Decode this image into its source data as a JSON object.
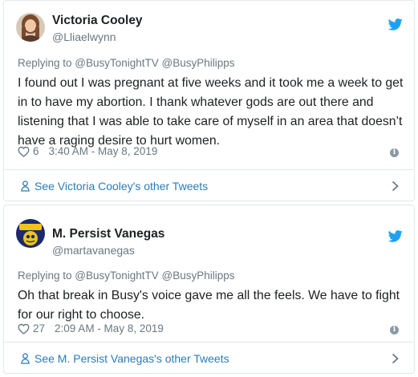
{
  "tweets": [
    {
      "author_name": "Victoria Cooley",
      "handle": "@Lliaelwynn",
      "reply_prefix": "Replying to ",
      "reply_mentions": "@BusyTonightTV @BusyPhilipps",
      "text": "I found out I was pregnant at five weeks and it took me a week to get in to have my abortion. I thank whatever gods are out there and listening that I was able to take care of myself in an area that doesn’t have a raging desire to hurt women.",
      "likes": "6",
      "timestamp": "3:40 AM - May 8, 2019",
      "other_tweets_label": "See Victoria Cooley's other Tweets",
      "avatar_icon": "avatar-photo-woman"
    },
    {
      "author_name": "M. Persist Vanegas",
      "handle": "@martavanegas",
      "reply_prefix": "Replying to ",
      "reply_mentions": "@BusyTonightTV @BusyPhilipps",
      "text": "Oh that break in Busy's voice gave me all the feels. We have to fight for our right to choose.",
      "likes": "27",
      "timestamp": "2:09 AM - May 8, 2019",
      "other_tweets_label": "See M. Persist Vanegas's other Tweets",
      "avatar_icon": "avatar-yes-we-can-badge"
    }
  ],
  "icons": {
    "brand": "twitter-bird-icon",
    "like": "heart-icon",
    "info": "info-icon",
    "profile": "person-icon",
    "chevron": "chevron-right-icon"
  },
  "colors": {
    "twitter_blue": "#1da1f2",
    "link_blue": "#2b7bb9",
    "meta_gray": "#697882",
    "text_dark": "#1c2022",
    "border": "#e1e8ed"
  }
}
